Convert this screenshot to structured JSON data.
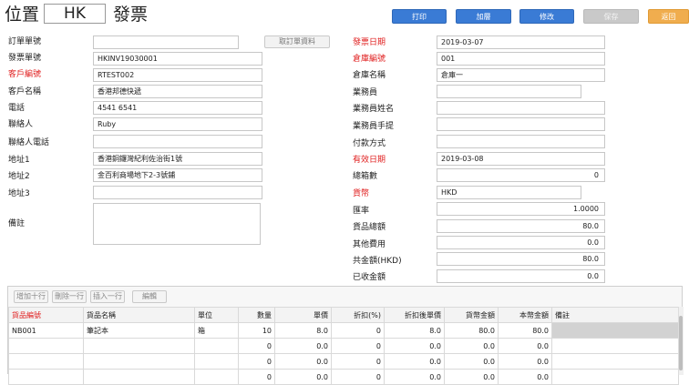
{
  "header": {
    "location_label": "位置",
    "location_value": "HK",
    "module_title": "發票",
    "buttons": {
      "print": "打印",
      "add": "加層",
      "edit": "修改",
      "save": "保存",
      "back": "返回"
    }
  },
  "left_form": {
    "order_no": {
      "label": "訂單單號",
      "value": ""
    },
    "fetch_order_button": "取訂單資料",
    "invoice_no": {
      "label": "發票單號",
      "value": "HKINV19030001"
    },
    "customer_code": {
      "label": "客戶編號",
      "value": "RTEST002"
    },
    "customer_name": {
      "label": "客戶名稱",
      "value": "香港邦德快遞"
    },
    "phone": {
      "label": "電話",
      "value": "4541 6541"
    },
    "contact": {
      "label": "聯絡人",
      "value": "Ruby"
    },
    "contact_phone": {
      "label": "聯絡人電話",
      "value": ""
    },
    "address1": {
      "label": "地址1",
      "value": "香港銅鑼灣紀利佐治街1號"
    },
    "address2": {
      "label": "地址2",
      "value": "金百利商場地下2-3號鋪"
    },
    "address3": {
      "label": "地址3",
      "value": ""
    },
    "remarks": {
      "label": "備註",
      "value": ""
    }
  },
  "right_form": {
    "invoice_date": {
      "label": "發票日期",
      "value": "2019-03-07"
    },
    "warehouse_code": {
      "label": "倉庫編號",
      "value": "001"
    },
    "warehouse_name": {
      "label": "倉庫名稱",
      "value": "倉庫一"
    },
    "salesperson": {
      "label": "業務員",
      "value": ""
    },
    "salesperson_name": {
      "label": "業務員姓名",
      "value": ""
    },
    "salesperson_mobile": {
      "label": "業務員手提",
      "value": ""
    },
    "payment_method": {
      "label": "付款方式",
      "value": ""
    },
    "valid_date": {
      "label": "有效日期",
      "value": "2019-03-08"
    },
    "total_boxes": {
      "label": "總箱數",
      "value": "0"
    },
    "currency": {
      "label": "貨幣",
      "value": "HKD"
    },
    "exchange_rate": {
      "label": "匯率",
      "value": "1.0000"
    },
    "goods_total": {
      "label": "貨品總額",
      "value": "80.0"
    },
    "other_fees": {
      "label": "其他費用",
      "value": "0.0"
    },
    "grand_total": {
      "label": "共金額(HKD)",
      "value": "80.0"
    },
    "received": {
      "label": "已收金額",
      "value": "0.0"
    }
  },
  "grid": {
    "toolbar": {
      "add_ten": "增加十行",
      "delete_row": "刪除一行",
      "insert_row": "插入一行",
      "edit": "編輯"
    },
    "columns": [
      "貨品編號",
      "貨品名稱",
      "單位",
      "數量",
      "單價",
      "折扣(%)",
      "折扣後單價",
      "貨幣金額",
      "本幣金額",
      "備註"
    ],
    "rows": [
      [
        "NB001",
        "筆記本",
        "箱",
        "10",
        "8.0",
        "0",
        "8.0",
        "80.0",
        "80.0",
        ""
      ],
      [
        "",
        "",
        "",
        "0",
        "0.0",
        "0",
        "0.0",
        "0.0",
        "0.0",
        ""
      ],
      [
        "",
        "",
        "",
        "0",
        "0.0",
        "0",
        "0.0",
        "0.0",
        "0.0",
        ""
      ],
      [
        "",
        "",
        "",
        "0",
        "0.0",
        "0",
        "0.0",
        "0.0",
        "0.0",
        ""
      ]
    ]
  },
  "colors": {
    "accent_blue": "#3a7bd5",
    "required_red": "#e02020",
    "back_orange": "#f0ad4e"
  }
}
